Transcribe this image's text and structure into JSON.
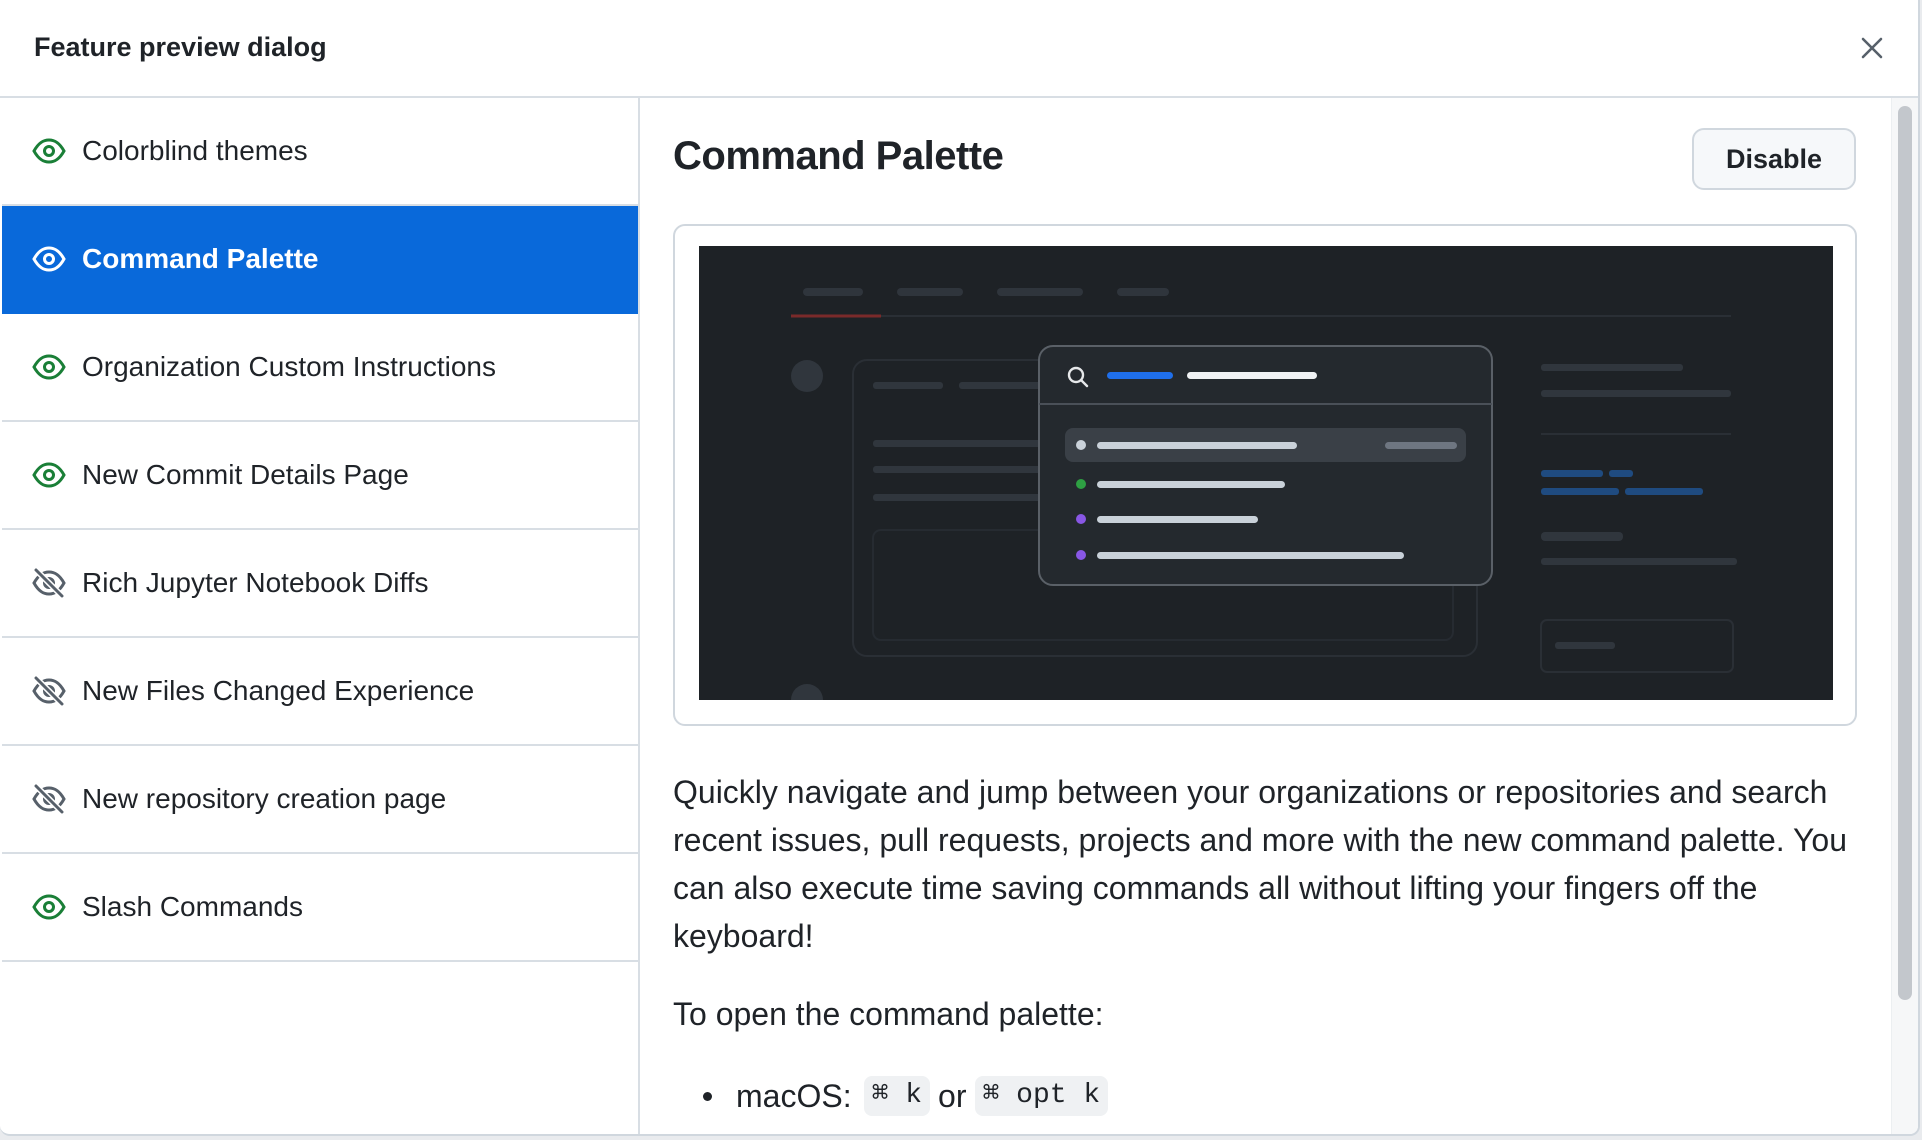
{
  "dialog": {
    "title": "Feature preview dialog",
    "close_icon": "close-icon"
  },
  "sidebar": {
    "items": [
      {
        "label": "Colorblind themes",
        "icon": "eye-icon",
        "active": false
      },
      {
        "label": "Command Palette",
        "icon": "eye-icon",
        "active": true
      },
      {
        "label": "Organization Custom Instructions",
        "icon": "eye-icon",
        "active": false
      },
      {
        "label": "New Commit Details Page",
        "icon": "eye-icon",
        "active": false
      },
      {
        "label": "Rich Jupyter Notebook Diffs",
        "icon": "eye-closed-icon",
        "active": false
      },
      {
        "label": "New Files Changed Experience",
        "icon": "eye-closed-icon",
        "active": false
      },
      {
        "label": "New repository creation page",
        "icon": "eye-closed-icon",
        "active": false
      },
      {
        "label": "Slash Commands",
        "icon": "eye-icon",
        "active": false
      }
    ]
  },
  "main": {
    "title": "Command Palette",
    "disable_label": "Disable",
    "description": "Quickly navigate and jump between your organizations or repositories and search recent issues, pull requests, projects and more with the new command palette. You can also execute time saving commands all without lifting your fingers off the keyboard!",
    "open_text": "To open the command palette:",
    "macos": {
      "label": "macOS:",
      "shortcut1": "⌘ k",
      "or": "or",
      "shortcut2": "⌘ opt k"
    }
  },
  "colors": {
    "accent": "#0969da",
    "enabled_icon": "#1a7f37",
    "disabled_icon": "#57606a"
  }
}
